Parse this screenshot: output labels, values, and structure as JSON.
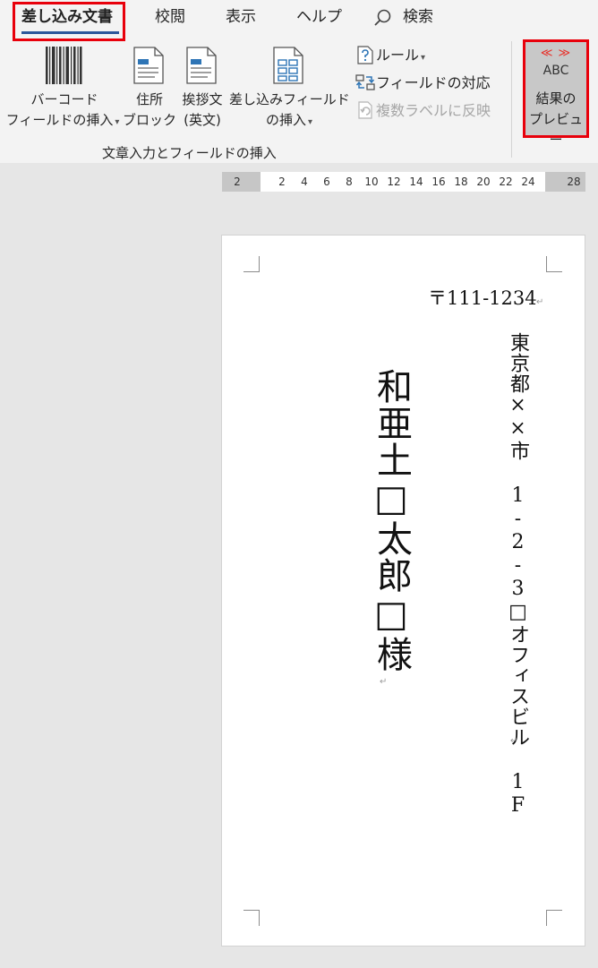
{
  "ribbon": {
    "tabs": [
      {
        "label": "差し込み文書",
        "active": true
      },
      {
        "label": "校閲",
        "active": false
      },
      {
        "label": "表示",
        "active": false
      },
      {
        "label": "ヘルプ",
        "active": false
      }
    ],
    "search_label": "検索",
    "commands": {
      "barcode": {
        "line1": "バーコード",
        "line2": "フィールドの挿入"
      },
      "address_block": {
        "line1": "住所",
        "line2": "ブロック"
      },
      "greeting": {
        "line1": "挨拶文",
        "line2": "(英文)"
      },
      "insert_merge_field": {
        "line1": "差し込みフィールド",
        "line2": "の挿入"
      },
      "rules": "ルール",
      "match_fields": "フィールドの対応",
      "update_labels": "複数ラベルに反映"
    },
    "group_label": "文章入力とフィールドの挿入",
    "preview": {
      "arrows": "≪ ≫",
      "abc": "ABC",
      "line1": "結果の",
      "line2": "プレビュー"
    },
    "accent_color": "#2b579a",
    "highlight_color": "#e8000b"
  },
  "ruler": {
    "ticks": [
      "2",
      "2",
      "4",
      "6",
      "8",
      "10",
      "12",
      "14",
      "16",
      "18",
      "20",
      "22",
      "24",
      "28"
    ]
  },
  "document": {
    "postal_code": "〒111-1234",
    "address": "東京都××市 1-2-3□オフィスビル 1F",
    "recipient": "和亜土□太郎□様",
    "return_mark": "↵"
  }
}
